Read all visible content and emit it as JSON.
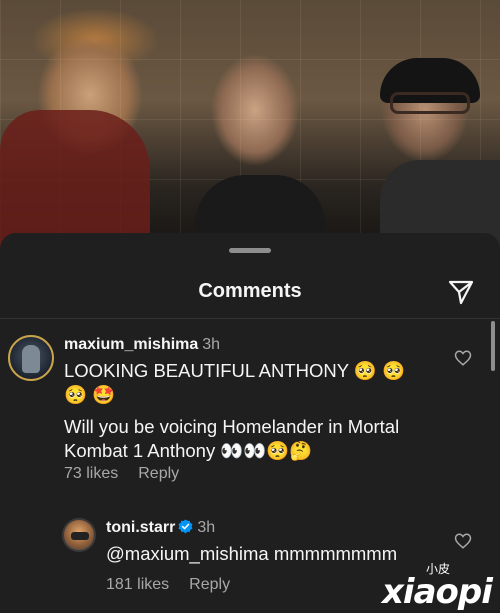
{
  "header": {
    "title": "Comments"
  },
  "comments": [
    {
      "username": "maxium_mishima",
      "time": "3h",
      "lines": [
        "LOOKING BEAUTIFUL ANTHONY 🥺 🥺",
        "🥺 🤩",
        "Will you be voicing Homelander in Mortal",
        "Kombat 1 Anthony 👀👀🥺🤔"
      ],
      "likes": "73 likes",
      "reply": "Reply"
    },
    {
      "username": "toni.starr",
      "time": "3h",
      "verified": true,
      "lines": [
        "@maxium_mishima mmmmmmmm"
      ],
      "likes": "181 likes",
      "reply": "Reply"
    }
  ],
  "watermark": {
    "cn": "小皮",
    "text": "xiaopi"
  },
  "colors": {
    "sheet": "#1f1f1f",
    "verified": "#0095f6",
    "secondary_text": "#a8a8a8"
  },
  "icons": [
    "share-icon",
    "heart-icon",
    "verified-badge-icon"
  ]
}
